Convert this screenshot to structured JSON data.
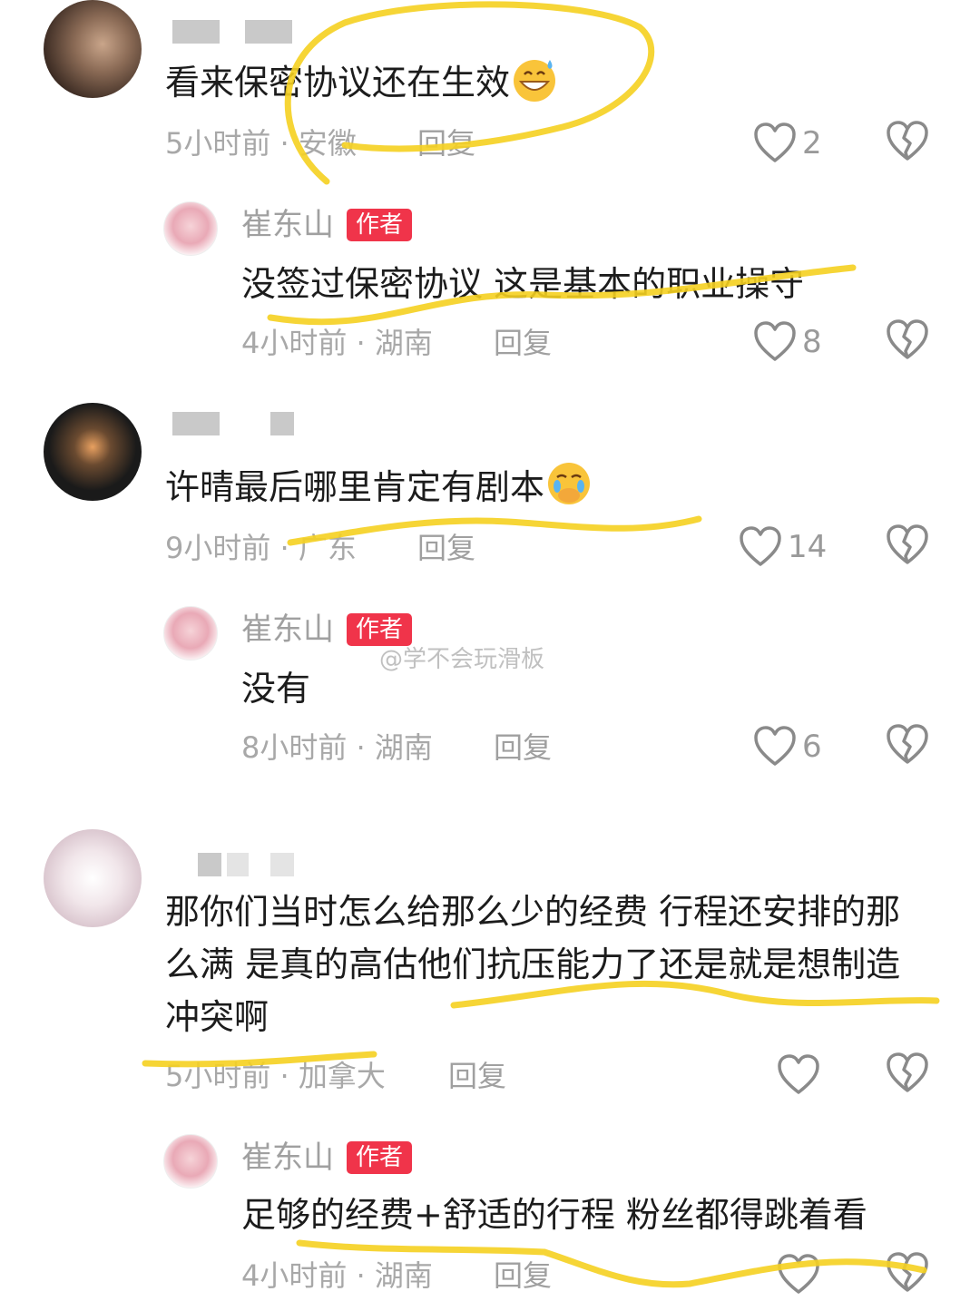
{
  "comments": [
    {
      "text": "看来保密协议还在生效",
      "emoji": "grinning-sweat-emoji",
      "time": "5小时前",
      "location": "安徽",
      "reply_label": "回复",
      "likes": "2",
      "reply": {
        "author": "崔东山",
        "badge": "作者",
        "text": "没签过保密协议 这是基本的职业操守",
        "time": "4小时前",
        "location": "湖南",
        "reply_label": "回复",
        "likes": "8"
      }
    },
    {
      "text": "许晴最后哪里肯定有剧本",
      "emoji": "crying-hand-over-mouth-emoji",
      "time": "9小时前",
      "location": "广东",
      "reply_label": "回复",
      "likes": "14",
      "reply": {
        "author": "崔东山",
        "badge": "作者",
        "text": "没有",
        "time": "8小时前",
        "location": "湖南",
        "reply_label": "回复",
        "likes": "6"
      }
    },
    {
      "text_lines": [
        "那你们当时怎么给那么少的经费 行程还安排的那",
        "么满 是真的高估他们抗压能力了还是就是想制造",
        "冲突啊"
      ],
      "time": "5小时前",
      "location": "加拿大",
      "reply_label": "回复",
      "likes": "",
      "reply": {
        "author": "崔东山",
        "badge": "作者",
        "text": "足够的经费+舒适的行程 粉丝都得跳着看",
        "time": "4小时前",
        "location": "湖南",
        "reply_label": "回复",
        "likes": ""
      }
    }
  ],
  "watermark": "@学不会玩滑板",
  "colors": {
    "badge": "#f0344a",
    "highlight": "#f5d020",
    "meta": "#a8a8a8"
  }
}
